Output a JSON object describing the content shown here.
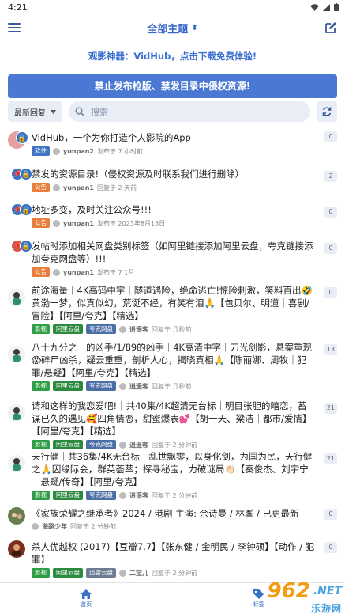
{
  "status": {
    "time": "4:21"
  },
  "header": {
    "title": "全部主题",
    "title_caret": "⬍"
  },
  "promo": "观影神器：VidHub，点击下载免费体验!",
  "notice": "禁止发布枪版、禁发目录中侵权资源!",
  "toolbar": {
    "sort_label": "最新回复",
    "search_placeholder": "搜索"
  },
  "items": [
    {
      "title": "VidHub，一个为你打造个人影院的App",
      "tags": [
        "软件"
      ],
      "user": "yunpan2",
      "time": "发布于 7 小时前",
      "count": "0"
    },
    {
      "title": "禁发的资源目录!（侵权资源及时联系我们进行删除）",
      "tags": [
        "公告"
      ],
      "user": "yunpan1",
      "time": "回复于 2 天前",
      "count": "2"
    },
    {
      "title": "地址多变，及时关注公众号!!!",
      "tags": [
        "公告"
      ],
      "user": "yunpan1",
      "time": "发布于 2023年8月15日",
      "count": "0"
    },
    {
      "title": "发帖时添加相关网盘类别标签（如阿里链接添加阿里云盘，夸克链接添加夸克网盘等）!!!",
      "tags": [
        "公告"
      ],
      "user": "yunpan1",
      "time": "发布于 7 1月",
      "count": "0"
    },
    {
      "title": "前途海量｜4K高码中字｜隧道遇险，绝命逃亡!惊险刺激，笑料百出🤣黄渤一梦，似真似幻，荒诞不经，有笑有泪🙏【包贝尔、明道｜喜剧/冒险】【阿里/夸克】【精选】",
      "tags": [
        "影视",
        "阿里云盘",
        "夸克网盘"
      ],
      "user": "逍遥客",
      "time": "回复于 几秒前",
      "count": "0"
    },
    {
      "title": "八十九分之一的凶手/1/89的凶手｜4K高清中字｜刀光剑影，悬案重现😱碎尸凶杀，疑云重重，剖析人心，揭晓真相🙏【陈丽娜、周牧｜犯罪/悬疑】【阿里/夸克】【精选】",
      "tags": [
        "影视",
        "阿里云盘",
        "夸克网盘"
      ],
      "user": "逍遥客",
      "time": "回复于 几秒前",
      "count": "13"
    },
    {
      "title": "请和这样的我恋爱吧!｜共40集/4K超清无台标｜明目张胆的暗恋，蓄谋已久的遇见🥰四角情恋，甜蜜爆表💕【胡一天、梁洁｜都市/爱情】【阿里/夸克】【精选】",
      "tags": [
        "影视",
        "阿里云盘",
        "夸克网盘"
      ],
      "user": "逍遥客",
      "time": "回复于 2 分钟前",
      "count": "21"
    },
    {
      "title": "天行健｜共36集/4K无台标｜乱世飘零，以身化剑，为国为民，天行健之🙏因缘际会，群英荟萃；探寻秘宝，力破谜局👏🏻【秦俊杰、刘宇宁｜悬疑/传奇】【阿里/夸克】",
      "tags": [
        "影视",
        "阿里云盘",
        "夸克网盘"
      ],
      "user": "逍遥客",
      "time": "回复于 2 分钟前",
      "count": "21"
    },
    {
      "title": "《家族荣耀之继承者》2024 / 港剧 主演: 佘诗曼 / 林峯 / 已更最新",
      "tags": [],
      "user": "海路少年",
      "time": "回复于 2 分钟前",
      "count": "0"
    },
    {
      "title": "杀人优越权 (2017)【豆瓣7.7】【张东健 / 金明民 / 李钟硕】【动作 / 犯罪】",
      "tags": [
        "影视",
        "阿里云盘",
        "迅雷云盘"
      ],
      "user": "二宝儿",
      "time": "回复于 2 分钟前",
      "count": "0"
    }
  ],
  "bottom_nav": {
    "home": "首页",
    "tags": "标签"
  },
  "watermark": {
    "num": "962",
    "net": ".NET",
    "sub": "乐游网"
  },
  "colors": {
    "accent": "#3567c9",
    "notice_bg": "#4a78d2"
  }
}
